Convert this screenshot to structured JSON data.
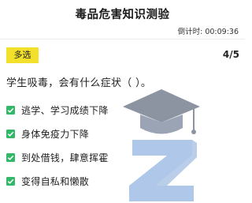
{
  "header": {
    "title": "毒品危害知识测验",
    "timer": "倒计时: 00:09:36"
  },
  "question": {
    "type_label": "多选",
    "progress": "4/5",
    "text": "学生吸毒，会有什么症状（ ）。",
    "options": [
      {
        "label": "逃学、学习成绩下降",
        "checked": true
      },
      {
        "label": "身体免疫力下降",
        "checked": true
      },
      {
        "label": "到处借钱，肆意挥霍",
        "checked": true
      },
      {
        "label": "变得自私和懒散",
        "checked": true
      }
    ]
  },
  "colors": {
    "badge": "#f2e02b",
    "check": "#33b86a"
  },
  "watermark_icon": "graduation-cap-z-logo"
}
